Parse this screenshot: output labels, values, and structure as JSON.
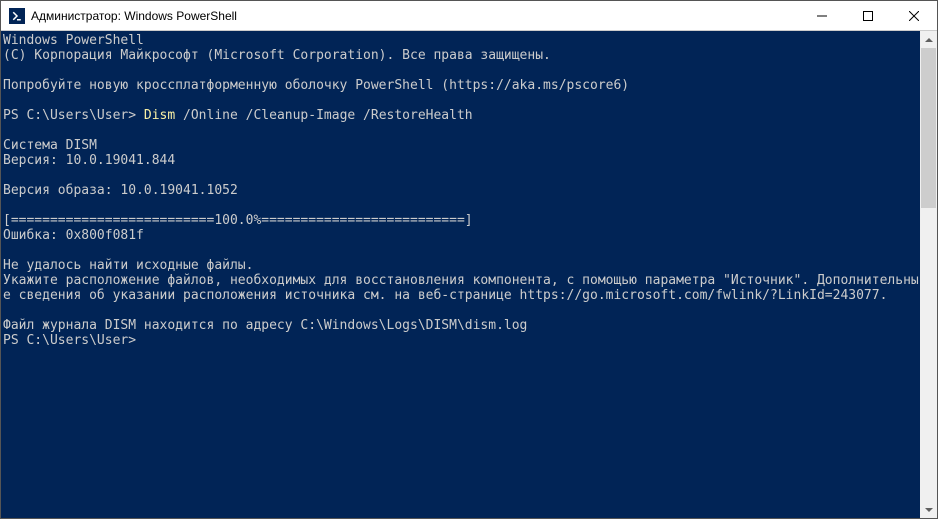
{
  "titlebar": {
    "title": "Администратор: Windows PowerShell"
  },
  "terminal": {
    "lines": {
      "l1": "Windows PowerShell",
      "l2": "(C) Корпорация Майкрософт (Microsoft Corporation). Все права защищены.",
      "l3": "",
      "l4": "Попробуйте новую кроссплатформенную оболочку PowerShell (https://aka.ms/pscore6)",
      "l5": "",
      "prompt1_ps": "PS ",
      "prompt1_path": "C:\\Users\\User> ",
      "prompt1_cmd": "Dism ",
      "prompt1_args": "/Online /Cleanup-Image /RestoreHealth",
      "l7": "",
      "l8": "Cистема DISM",
      "l9": "Версия: 10.0.19041.844",
      "l10": "",
      "l11": "Версия образа: 10.0.19041.1052",
      "l12": "",
      "l13": "[==========================100.0%==========================]",
      "l14": "Ошибка: 0x800f081f",
      "l15": "",
      "l16": "Не удалось найти исходные файлы.",
      "l17": "Укажите расположение файлов, необходимых для восстановления компонента, с помощью параметра \"Источник\". Дополнительные сведения об указании расположения источника см. на веб-странице https://go.microsoft.com/fwlink/?LinkId=243077.",
      "l18": "",
      "l19": "Файл журнала DISM находится по адресу C:\\Windows\\Logs\\DISM\\dism.log",
      "prompt2_ps": "PS ",
      "prompt2_path": "C:\\Users\\User>"
    }
  }
}
